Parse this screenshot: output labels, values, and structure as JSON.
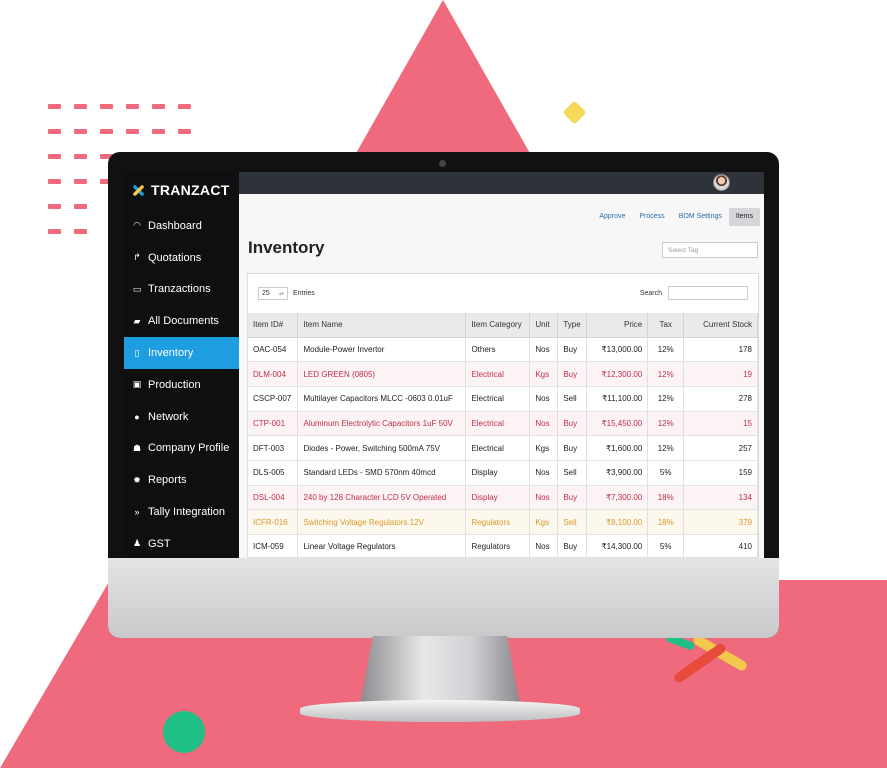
{
  "app": {
    "brand": "TRANZACT"
  },
  "sidebar": {
    "items": [
      {
        "label": "Dashboard",
        "icon": "gauge-icon"
      },
      {
        "label": "Quotations",
        "icon": "arrow-turn-icon"
      },
      {
        "label": "Tranzactions",
        "icon": "document-icon"
      },
      {
        "label": "All Documents",
        "icon": "folder-icon"
      },
      {
        "label": "Inventory",
        "icon": "clipboard-icon",
        "active": true
      },
      {
        "label": "Production",
        "icon": "box-icon"
      },
      {
        "label": "Network",
        "icon": "globe-icon"
      },
      {
        "label": "Company Profile",
        "icon": "people-icon"
      },
      {
        "label": "Reports",
        "icon": "bulb-icon"
      },
      {
        "label": "Tally Integration",
        "icon": "double-chevron-icon"
      },
      {
        "label": "GST",
        "icon": "money-bag-icon"
      }
    ]
  },
  "header": {
    "tabs": [
      "Approve",
      "Process",
      "BOM Settings",
      "Items"
    ],
    "active_tab": "Items"
  },
  "main": {
    "title": "Inventory",
    "tag_placeholder": "Select Tag",
    "entries_value": "25",
    "entries_label": "Entries",
    "search_label": "Search"
  },
  "table": {
    "columns": [
      "Item ID#",
      "Item Name",
      "Item Category",
      "Unit",
      "Type",
      "Price",
      "Tax",
      "Current Stock"
    ],
    "rows": [
      {
        "id": "OAC-054",
        "name": "Module-Power Invertor",
        "category": "Others",
        "unit": "Nos",
        "type": "Buy",
        "price": "₹13,000.00",
        "tax": "12%",
        "stock": "178",
        "status": "normal"
      },
      {
        "id": "DLM-004",
        "name": "LED GREEN (0805)",
        "category": "Electrical",
        "unit": "Kgs",
        "type": "Buy",
        "price": "₹12,300.00",
        "tax": "12%",
        "stock": "19",
        "status": "low"
      },
      {
        "id": "CSCP-007",
        "name": "Multilayer Capacitors MLCC -0603 0.01uF",
        "category": "Electrical",
        "unit": "Nos",
        "type": "Sell",
        "price": "₹11,100.00",
        "tax": "12%",
        "stock": "278",
        "status": "normal"
      },
      {
        "id": "CTP-001",
        "name": "Aluminum Electrolytic Capacitors 1uF 50V",
        "category": "Electrical",
        "unit": "Nos",
        "type": "Buy",
        "price": "₹15,450.00",
        "tax": "12%",
        "stock": "15",
        "status": "low"
      },
      {
        "id": "DFT-003",
        "name": "Diodes - Power, Switching 500mA 75V",
        "category": "Electrical",
        "unit": "Kgs",
        "type": "Buy",
        "price": "₹1,600.00",
        "tax": "12%",
        "stock": "257",
        "status": "normal"
      },
      {
        "id": "DLS-005",
        "name": "Standard LEDs - SMD 570nm 40mcd",
        "category": "Display",
        "unit": "Nos",
        "type": "Sell",
        "price": "₹3,900.00",
        "tax": "5%",
        "stock": "159",
        "status": "normal"
      },
      {
        "id": "DSL-004",
        "name": "240 by 128 Character LCD 5V Operated",
        "category": "Display",
        "unit": "Nos",
        "type": "Buy",
        "price": "₹7,300.00",
        "tax": "18%",
        "stock": "134",
        "status": "low"
      },
      {
        "id": "ICFR-016",
        "name": "Switching Voltage Regulators 12V",
        "category": "Regulators",
        "unit": "Kgs",
        "type": "Sell",
        "price": "₹8,100.00",
        "tax": "18%",
        "stock": "379",
        "status": "warn"
      },
      {
        "id": "ICM-059",
        "name": "Linear Voltage Regulators",
        "category": "Regulators",
        "unit": "Nos",
        "type": "Buy",
        "price": "₹14,300.00",
        "tax": "5%",
        "stock": "410",
        "status": "normal"
      }
    ]
  },
  "colors": {
    "accent": "#1e9ee0",
    "sidebar_bg": "#0e0f11",
    "low_stock": "#c0304a",
    "warn_stock": "#d89a2a",
    "decor_pink": "#ee6a7c",
    "decor_green": "#1fbf86",
    "decor_yellow": "#f6d95b"
  }
}
